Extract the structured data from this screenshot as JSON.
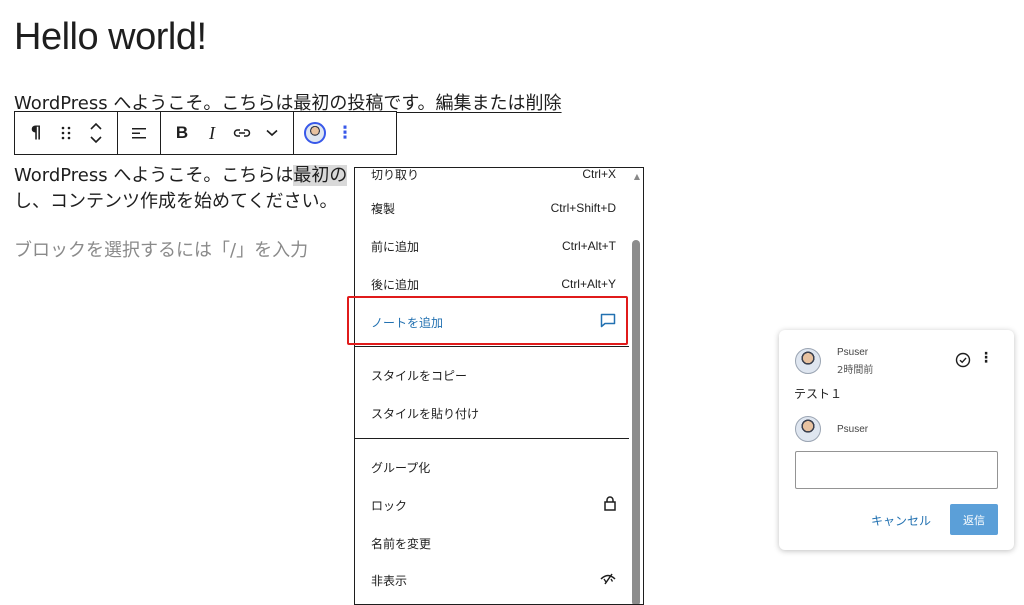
{
  "post": {
    "title": "Hello world!",
    "paragraph_behind": "WordPress へようこそ。こちらは最初の投稿です。編集または削除",
    "paragraph_line1_before": "WordPress へようこそ。こちらは",
    "paragraph_line1_highlight": "最初の",
    "paragraph_line2": "し、コンテンツ作成を始めてください。",
    "placeholder": "ブロックを選択するには「/」を入力"
  },
  "toolbar": {
    "paragraph_icon": "¶",
    "drag_icon": "⠿",
    "move_icon": "⌃⌄",
    "align_icon": "☰",
    "bold": "B",
    "italic": "I",
    "link_icon": "⛓",
    "more_rich_icon": "⌄",
    "options_icon": "⋮"
  },
  "menu": {
    "items": [
      {
        "label": "切り取り",
        "shortcut": "Ctrl+X"
      },
      {
        "label": "複製",
        "shortcut": "Ctrl+Shift+D"
      },
      {
        "label": "前に追加",
        "shortcut": "Ctrl+Alt+T"
      },
      {
        "label": "後に追加",
        "shortcut": "Ctrl+Alt+Y"
      },
      {
        "label": "ノートを追加",
        "shortcut": ""
      },
      {
        "label": "スタイルをコピー",
        "shortcut": ""
      },
      {
        "label": "スタイルを貼り付け",
        "shortcut": ""
      },
      {
        "label": "グループ化",
        "shortcut": ""
      },
      {
        "label": "ロック",
        "shortcut": ""
      },
      {
        "label": "名前を変更",
        "shortcut": ""
      },
      {
        "label": "非表示",
        "shortcut": ""
      }
    ]
  },
  "comment": {
    "author": "Psuser",
    "time": "2時間前",
    "text": "テスト１",
    "reply_author": "Psuser",
    "reply_value": "",
    "cancel_label": "キャンセル",
    "reply_label": "返信"
  },
  "colors": {
    "accent": "#3858e9",
    "link_blue": "#2271b1",
    "highlight_frame": "#e01b1b",
    "reply_button": "#3f8fd2"
  }
}
